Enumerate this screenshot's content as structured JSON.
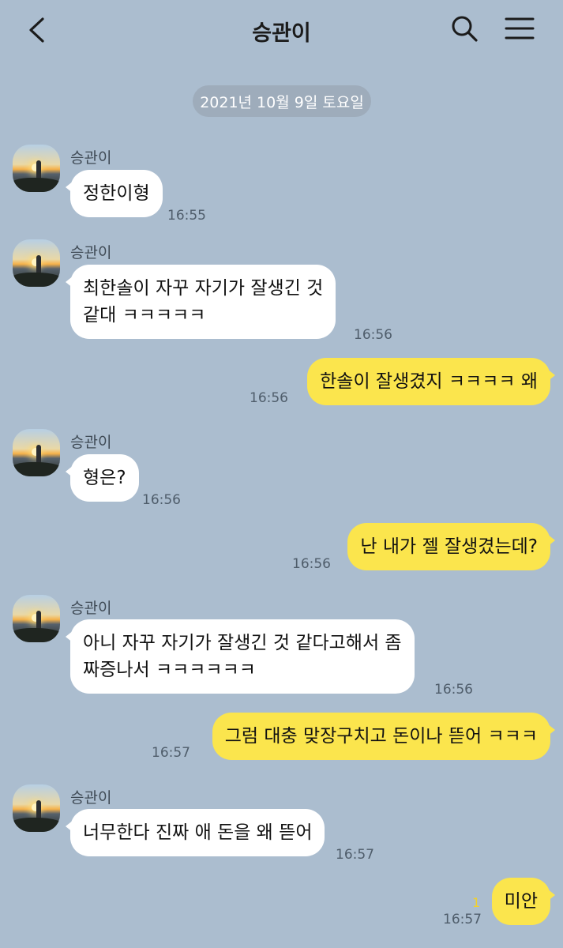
{
  "header": {
    "title": "승관이",
    "back_icon": "chevron-left-icon",
    "search_icon": "search-icon",
    "menu_icon": "hamburger-menu-icon"
  },
  "date_divider": "2021년 10월 9일 토요일",
  "messages": [
    {
      "direction": "in",
      "sender": "승관이",
      "lines": [
        "정한이형"
      ],
      "time": "16:55"
    },
    {
      "direction": "in",
      "sender": "승관이",
      "lines": [
        "최한솔이 자꾸 자기가 잘생긴 것",
        "같대 ㅋㅋㅋㅋㅋ"
      ],
      "time": "16:56"
    },
    {
      "direction": "out",
      "lines": [
        "한솔이 잘생겼지 ㅋㅋㅋㅋ 왜"
      ],
      "time": "16:56"
    },
    {
      "direction": "in",
      "sender": "승관이",
      "lines": [
        "형은?"
      ],
      "time": "16:56"
    },
    {
      "direction": "out",
      "lines": [
        "난 내가 젤 잘생겼는데?"
      ],
      "time": "16:56"
    },
    {
      "direction": "in",
      "sender": "승관이",
      "lines": [
        "아니 자꾸 자기가 잘생긴 것 같다고해서 좀",
        "짜증나서 ㅋㅋㅋㅋㅋㅋ"
      ],
      "time": "16:56"
    },
    {
      "direction": "out",
      "lines": [
        "그럼 대충 맞장구치고 돈이나 뜯어 ㅋㅋㅋ"
      ],
      "time": "16:57"
    },
    {
      "direction": "in",
      "sender": "승관이",
      "lines": [
        "너무한다 진짜 애 돈을 왜 뜯어"
      ],
      "time": "16:57"
    },
    {
      "direction": "out",
      "lines": [
        "미안"
      ],
      "time": "16:57",
      "unread": "1"
    }
  ],
  "colors": {
    "background": "#abbdcf",
    "outgoing_bubble": "#fbe54d",
    "incoming_bubble": "#ffffff",
    "unread_count": "#f2d12a"
  }
}
